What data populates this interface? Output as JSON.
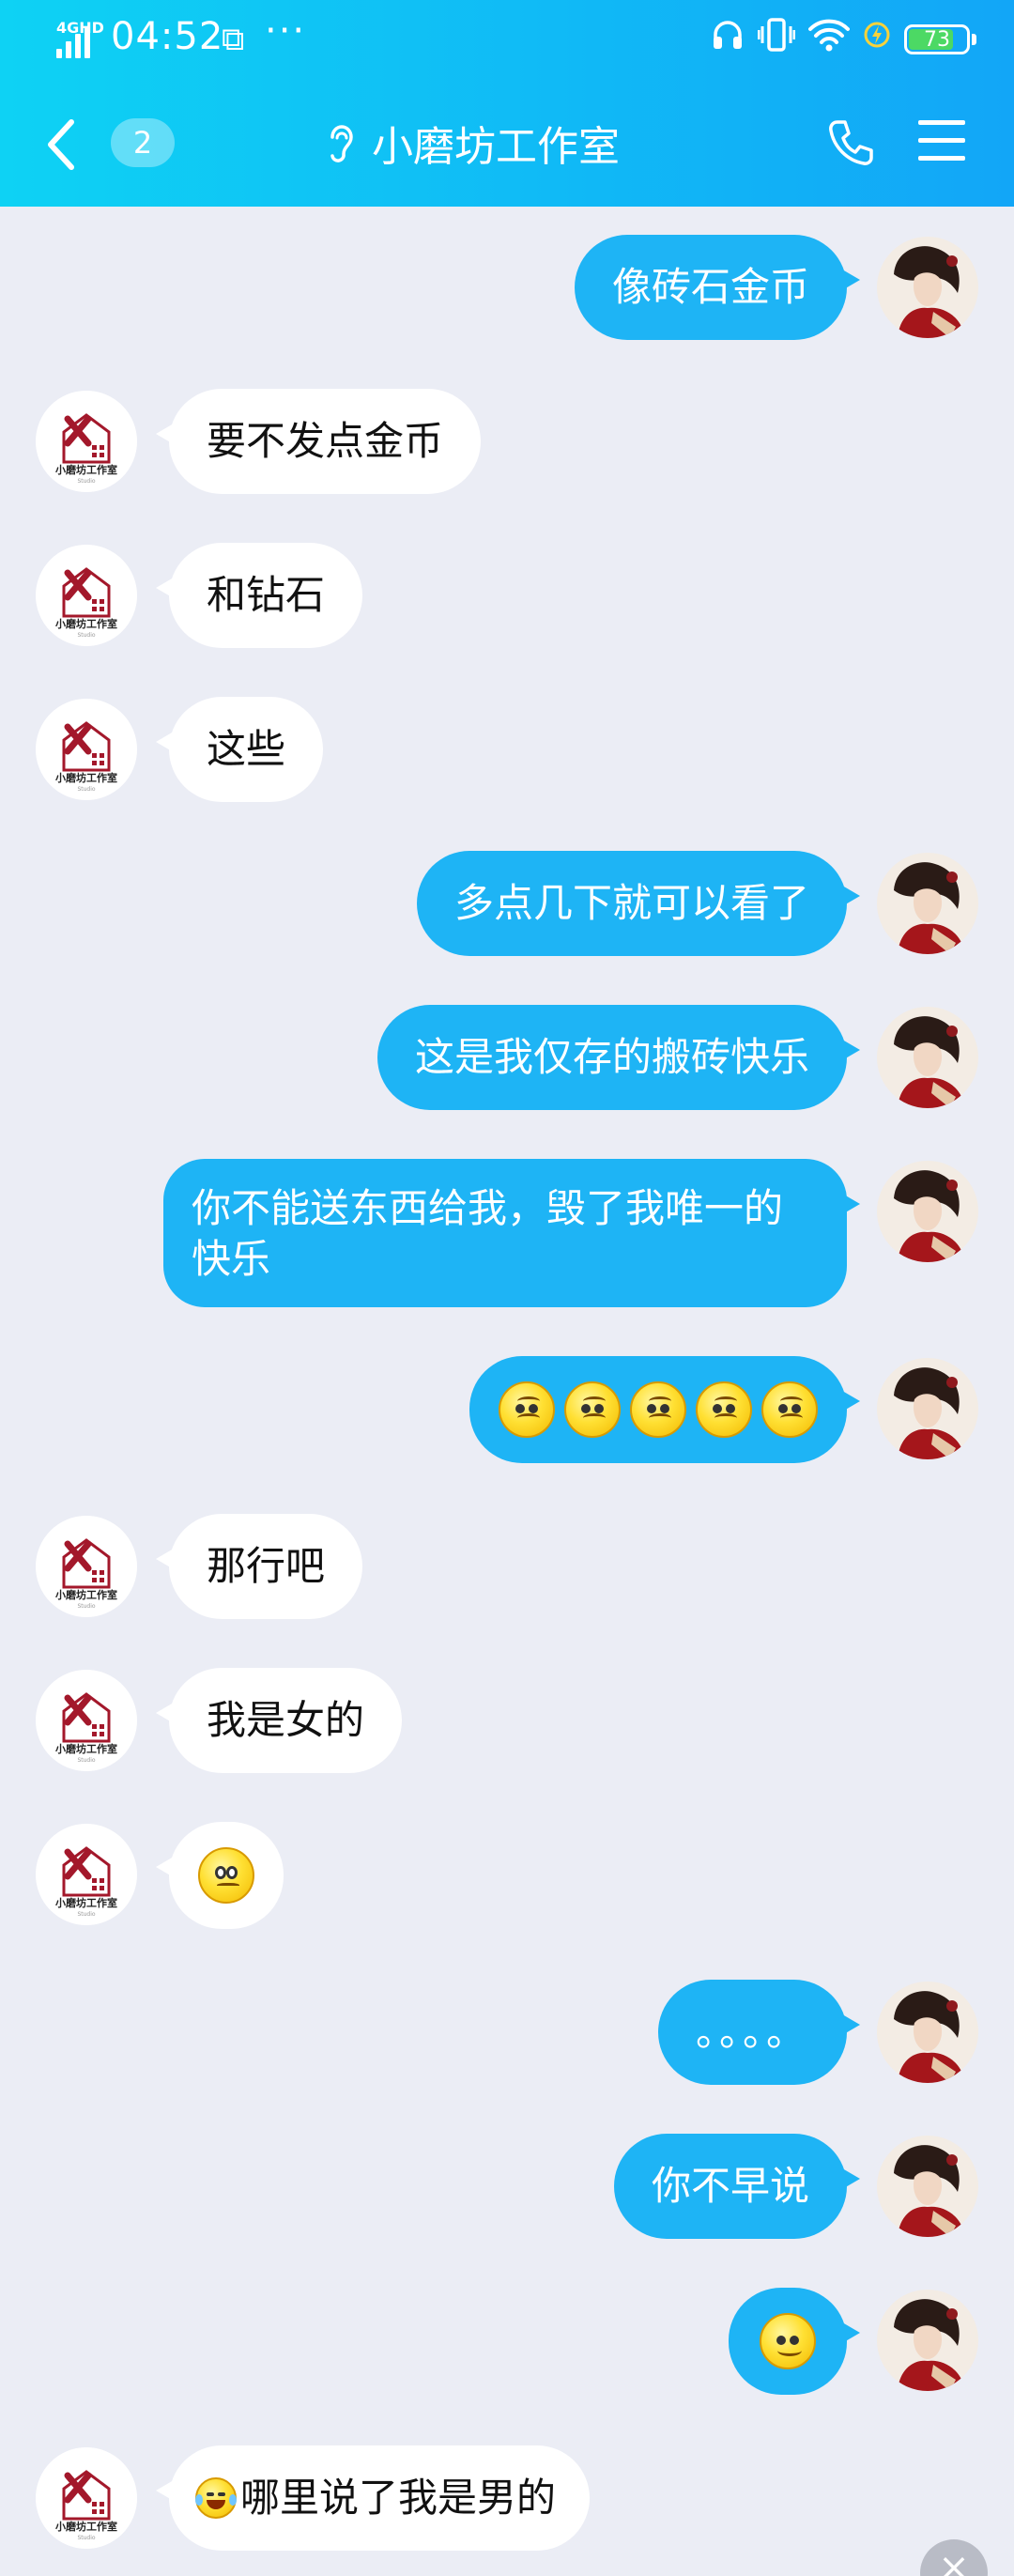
{
  "status_bar": {
    "network": "4GHD",
    "time": "04:52",
    "battery": "73",
    "battery_level_percent": 73,
    "icons": [
      "signal-icon",
      "sync-app-icon",
      "more-dots-icon",
      "headphones-icon",
      "vibrate-icon",
      "wifi-icon",
      "power-saving-icon",
      "battery-icon"
    ]
  },
  "header": {
    "unread_count": "2",
    "chat_title": "小磨坊工作室",
    "icons": [
      "back-icon",
      "earpiece-icon",
      "phone-icon",
      "menu-icon"
    ]
  },
  "contact": {
    "avatar_text": "小磨坊工作室",
    "avatar_subtext": "Studio"
  },
  "colors": {
    "header_start": "#0ed2f4",
    "header_end": "#12a6f7",
    "outgoing_bubble": "#1eb4f5",
    "incoming_bubble": "#ffffff",
    "background": "#ebedf5"
  },
  "messages": [
    {
      "side": "right",
      "text": "像砖石金币"
    },
    {
      "side": "left",
      "text": "要不发点金币"
    },
    {
      "side": "left",
      "text": "和钻石"
    },
    {
      "side": "left",
      "text": "这些"
    },
    {
      "side": "right",
      "text": "多点几下就可以看了"
    },
    {
      "side": "right",
      "text": "这是我仅存的搬砖快乐"
    },
    {
      "side": "right",
      "text": "你不能送东西给我，毁了我唯一的快乐"
    },
    {
      "side": "right",
      "emoji": "sad-face-emoji",
      "emoji_count": 5
    },
    {
      "side": "left",
      "text": "那行吧"
    },
    {
      "side": "left",
      "text": "我是女的"
    },
    {
      "side": "left",
      "emoji": "worried-face-emoji",
      "emoji_count": 1
    },
    {
      "side": "right",
      "text": "。。。。"
    },
    {
      "side": "right",
      "text": "你不早说"
    },
    {
      "side": "right",
      "emoji": "smile-face-emoji",
      "emoji_count": 1
    },
    {
      "side": "left",
      "emoji": "laughing-tears-emoji",
      "text": "哪里说了我是男的"
    }
  ]
}
